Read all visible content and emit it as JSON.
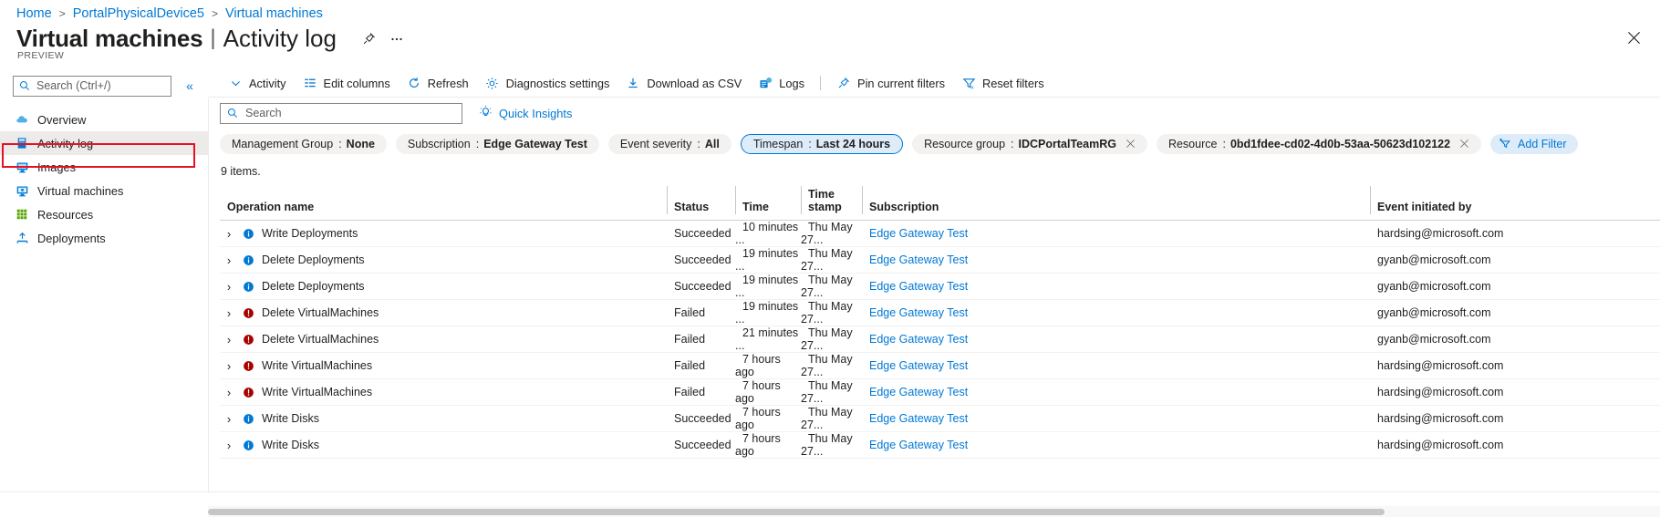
{
  "breadcrumb": {
    "items": [
      "Home",
      "PortalPhysicalDevice5",
      "Virtual machines"
    ],
    "separator": ">"
  },
  "header": {
    "title_main": "Virtual machines",
    "title_divider": "|",
    "title_sub": "Activity log",
    "preview_label": "PREVIEW",
    "pin_icon": "pin-icon",
    "more_icon": "ellipsis-icon",
    "close_icon": "close-icon"
  },
  "sidebar": {
    "search_placeholder": "Search (Ctrl+/)",
    "search_value": "",
    "search_icon": "search-icon",
    "collapse_icon": "chevron-double-left-icon",
    "items": [
      {
        "label": "Overview",
        "icon": "cloud-icon",
        "selected": false
      },
      {
        "label": "Activity log",
        "icon": "activity-log-icon",
        "selected": true
      },
      {
        "label": "Images",
        "icon": "images-icon",
        "selected": false
      },
      {
        "label": "Virtual machines",
        "icon": "virtual-machine-icon",
        "selected": false
      },
      {
        "label": "Resources",
        "icon": "resources-grid-icon",
        "selected": false
      },
      {
        "label": "Deployments",
        "icon": "deployments-upload-icon",
        "selected": false
      }
    ]
  },
  "toolbar": {
    "items": [
      {
        "label": "Activity",
        "icon": "chevron-down-icon"
      },
      {
        "label": "Edit columns",
        "icon": "columns-icon"
      },
      {
        "label": "Refresh",
        "icon": "refresh-icon"
      },
      {
        "label": "Diagnostics settings",
        "icon": "gear-icon"
      },
      {
        "label": "Download as CSV",
        "icon": "download-icon"
      },
      {
        "label": "Logs",
        "icon": "logs-icon"
      },
      {
        "label": "Pin current filters",
        "icon": "pin-icon"
      },
      {
        "label": "Reset filters",
        "icon": "filter-reset-icon"
      }
    ]
  },
  "search": {
    "placeholder": "Search",
    "value": "",
    "icon": "search-icon"
  },
  "quick_insights": {
    "label": "Quick Insights",
    "icon": "lightbulb-icon"
  },
  "filters": {
    "pills": [
      {
        "name": "Management Group",
        "sep": ":",
        "value": "None",
        "active": false,
        "removable": false
      },
      {
        "name": "Subscription",
        "sep": ":",
        "value": "Edge Gateway Test",
        "active": false,
        "removable": false
      },
      {
        "name": "Event severity",
        "sep": ":",
        "value": "All",
        "active": false,
        "removable": false
      },
      {
        "name": "Timespan",
        "sep": ":",
        "value": "Last 24 hours",
        "active": true,
        "removable": false
      },
      {
        "name": "Resource group",
        "sep": ":",
        "value": "IDCPortalTeamRG",
        "active": false,
        "removable": true
      },
      {
        "name": "Resource",
        "sep": ":",
        "value": "0bd1fdee-cd02-4d0b-53aa-50623d102122",
        "active": false,
        "removable": true
      }
    ],
    "add_filter_label": "Add Filter",
    "add_filter_icon": "add-filter-icon",
    "remove_icon": "close-icon"
  },
  "table": {
    "items_count": "9 items.",
    "columns": [
      "Operation name",
      "Status",
      "Time",
      "Time stamp",
      "Subscription",
      "Event initiated by"
    ],
    "rows": [
      {
        "expand_icon": "chevron-right-icon",
        "severity": "informational",
        "operation": "Write Deployments",
        "status": "Succeeded",
        "time": "10 minutes ...",
        "timestamp": "Thu May 27...",
        "subscription": "Edge Gateway Test",
        "initiated_by": "hardsing@microsoft.com"
      },
      {
        "expand_icon": "chevron-right-icon",
        "severity": "informational",
        "operation": "Delete Deployments",
        "status": "Succeeded",
        "time": "19 minutes ...",
        "timestamp": "Thu May 27...",
        "subscription": "Edge Gateway Test",
        "initiated_by": "gyanb@microsoft.com"
      },
      {
        "expand_icon": "chevron-right-icon",
        "severity": "informational",
        "operation": "Delete Deployments",
        "status": "Succeeded",
        "time": "19 minutes ...",
        "timestamp": "Thu May 27...",
        "subscription": "Edge Gateway Test",
        "initiated_by": "gyanb@microsoft.com"
      },
      {
        "expand_icon": "chevron-right-icon",
        "severity": "error",
        "operation": "Delete VirtualMachines",
        "status": "Failed",
        "time": "19 minutes ...",
        "timestamp": "Thu May 27...",
        "subscription": "Edge Gateway Test",
        "initiated_by": "gyanb@microsoft.com"
      },
      {
        "expand_icon": "chevron-right-icon",
        "severity": "error",
        "operation": "Delete VirtualMachines",
        "status": "Failed",
        "time": "21 minutes ...",
        "timestamp": "Thu May 27...",
        "subscription": "Edge Gateway Test",
        "initiated_by": "gyanb@microsoft.com"
      },
      {
        "expand_icon": "chevron-right-icon",
        "severity": "error",
        "operation": "Write VirtualMachines",
        "status": "Failed",
        "time": "7 hours ago",
        "timestamp": "Thu May 27...",
        "subscription": "Edge Gateway Test",
        "initiated_by": "hardsing@microsoft.com"
      },
      {
        "expand_icon": "chevron-right-icon",
        "severity": "error",
        "operation": "Write VirtualMachines",
        "status": "Failed",
        "time": "7 hours ago",
        "timestamp": "Thu May 27...",
        "subscription": "Edge Gateway Test",
        "initiated_by": "hardsing@microsoft.com"
      },
      {
        "expand_icon": "chevron-right-icon",
        "severity": "informational",
        "operation": "Write Disks",
        "status": "Succeeded",
        "time": "7 hours ago",
        "timestamp": "Thu May 27...",
        "subscription": "Edge Gateway Test",
        "initiated_by": "hardsing@microsoft.com"
      },
      {
        "expand_icon": "chevron-right-icon",
        "severity": "informational",
        "operation": "Write Disks",
        "status": "Succeeded",
        "time": "7 hours ago",
        "timestamp": "Thu May 27...",
        "subscription": "Edge Gateway Test",
        "initiated_by": "hardsing@microsoft.com"
      }
    ]
  },
  "colors": {
    "accent": "#0078d4",
    "error": "#a80000",
    "info": "#0078d4",
    "highlight_border": "#e81123",
    "pill_bg": "#f3f2f1",
    "pill_active_bg": "#deecf9"
  }
}
